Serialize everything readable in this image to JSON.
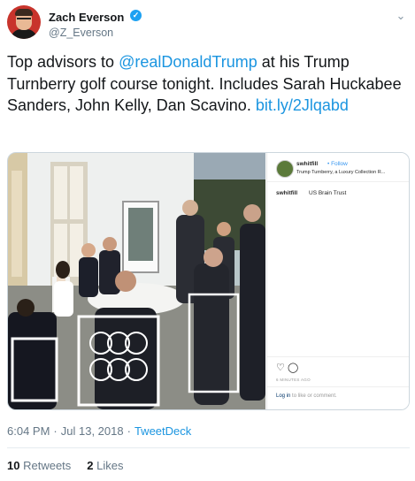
{
  "author": {
    "name": "Zach Everson",
    "handle": "@Z_Everson",
    "verified_icon": "verified-badge-icon"
  },
  "tweet": {
    "text_part1": "Top advisors to ",
    "mention": "@realDonaldTrump",
    "text_part2": " at his Trump Turnberry golf course tonight. Includes Sarah Huckabee Sanders, John Kelly, Dan Scavino. ",
    "link": "bit.ly/2Jlqabd"
  },
  "embed": {
    "user": "swhitfill",
    "follow": "• Follow",
    "location": "Trump Turnberry, a Luxury Collection R...",
    "caption_user": "swhitfill",
    "caption": "US Brain Trust",
    "time": "6 MINUTES AGO",
    "login_link": "Log in",
    "login_rest": " to like or comment."
  },
  "meta": {
    "time": "6:04 PM",
    "date": "Jul 13, 2018",
    "via": "TweetDeck"
  },
  "stats": {
    "retweets_count": "10",
    "retweets_label": "Retweets",
    "likes_count": "2",
    "likes_label": "Likes"
  },
  "colors": {
    "link": "#1b95e0",
    "verified": "#1da1f2",
    "muted": "#657786"
  }
}
